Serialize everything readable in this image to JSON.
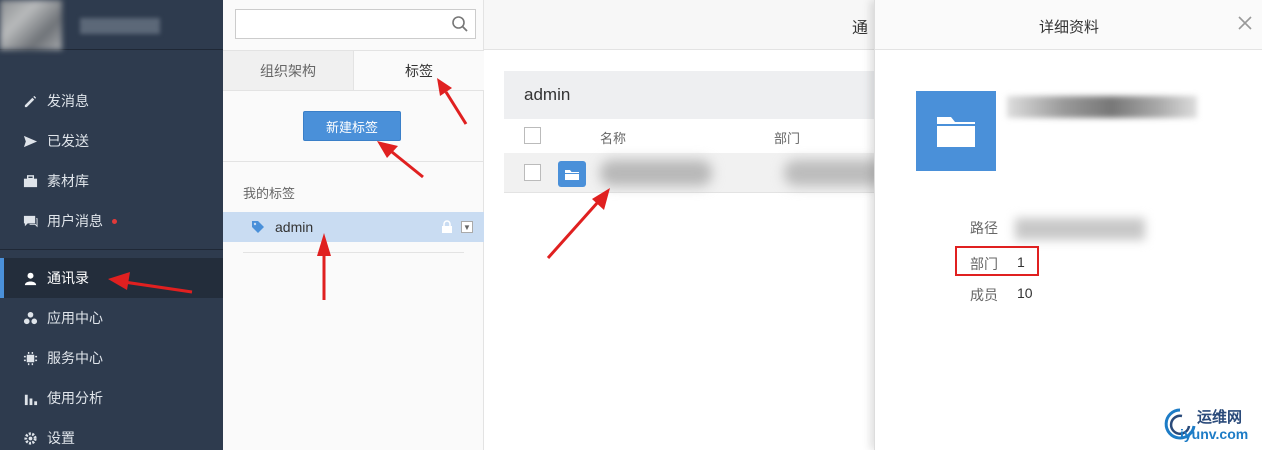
{
  "sidebar": {
    "items": [
      {
        "label": "发消息",
        "icon": "pencil-icon"
      },
      {
        "label": "已发送",
        "icon": "send-icon"
      },
      {
        "label": "素材库",
        "icon": "briefcase-icon"
      },
      {
        "label": "用户消息",
        "icon": "chat-icon"
      },
      {
        "label": "通讯录",
        "icon": "user-icon"
      },
      {
        "label": "应用中心",
        "icon": "apps-icon"
      },
      {
        "label": "服务中心",
        "icon": "chip-icon"
      },
      {
        "label": "使用分析",
        "icon": "bar-chart-icon"
      },
      {
        "label": "设置",
        "icon": "gear-icon"
      }
    ],
    "active_index": 4
  },
  "tag_panel": {
    "tabs": [
      "组织架构",
      "标签"
    ],
    "active_tab": 1,
    "new_tag_button": "新建标签",
    "my_tags_heading": "我的标签",
    "tags": [
      {
        "name": "admin"
      }
    ]
  },
  "main": {
    "title": "通",
    "group_name": "admin",
    "columns": [
      "名称",
      "部门"
    ]
  },
  "detail": {
    "title": "详细资料",
    "path_label": "路径",
    "dept_label": "部门",
    "dept_value": "1",
    "members_label": "成员",
    "members_value": "10"
  },
  "watermark": {
    "text_cn": "运维网",
    "text_url": "iyunv.com"
  },
  "colors": {
    "sidebar_bg": "#2e3b4e",
    "accent": "#4a90d9",
    "annotation_red": "#e02020"
  }
}
